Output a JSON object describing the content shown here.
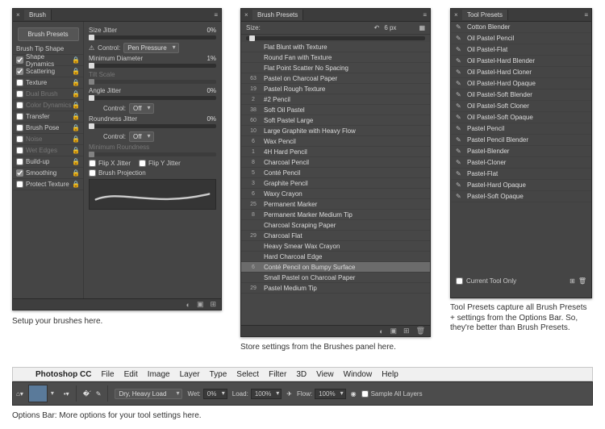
{
  "brush": {
    "title": "Brush",
    "presets_btn": "Brush Presets",
    "tip_shape": "Brush Tip Shape",
    "groups": [
      {
        "label": "Shape Dynamics",
        "checked": true,
        "enabled": true
      },
      {
        "label": "Scattering",
        "checked": true,
        "enabled": true
      },
      {
        "label": "Texture",
        "checked": false,
        "enabled": true
      },
      {
        "label": "Dual Brush",
        "checked": false,
        "enabled": false
      },
      {
        "label": "Color Dynamics",
        "checked": false,
        "enabled": false
      },
      {
        "label": "Transfer",
        "checked": false,
        "enabled": true
      },
      {
        "label": "Brush Pose",
        "checked": false,
        "enabled": true
      },
      {
        "label": "Noise",
        "checked": false,
        "enabled": false
      },
      {
        "label": "Wet Edges",
        "checked": false,
        "enabled": false
      },
      {
        "label": "Build-up",
        "checked": false,
        "enabled": true
      },
      {
        "label": "Smoothing",
        "checked": true,
        "enabled": true
      },
      {
        "label": "Protect Texture",
        "checked": false,
        "enabled": true
      }
    ],
    "size_jitter": {
      "label": "Size Jitter",
      "value": "0%"
    },
    "control1": {
      "label": "Control:",
      "value": "Pen Pressure"
    },
    "min_diameter": {
      "label": "Minimum Diameter",
      "value": "1%"
    },
    "tilt_scale": {
      "label": "Tilt Scale"
    },
    "angle_jitter": {
      "label": "Angle Jitter",
      "value": "0%"
    },
    "control2": {
      "label": "Control:",
      "value": "Off"
    },
    "roundness_jitter": {
      "label": "Roundness Jitter",
      "value": "0%"
    },
    "control3": {
      "label": "Control:",
      "value": "Off"
    },
    "min_roundness": {
      "label": "Minimum Roundness"
    },
    "flip_x": "Flip X Jitter",
    "flip_y": "Flip Y Jitter",
    "brush_projection": "Brush Projection"
  },
  "brush_caption": "Setup your brushes here.",
  "presets": {
    "title": "Brush Presets",
    "size_label": "Size:",
    "size_value": "6 px",
    "items": [
      {
        "n": "",
        "name": "Flat Blunt with Texture"
      },
      {
        "n": "",
        "name": "Round Fan with Texture"
      },
      {
        "n": "",
        "name": "Flat Point Scatter No Spacing"
      },
      {
        "n": "63",
        "name": "Pastel on Charcoal Paper"
      },
      {
        "n": "19",
        "name": "Pastel Rough Texture"
      },
      {
        "n": "2",
        "name": "#2 Pencil"
      },
      {
        "n": "38",
        "name": "Soft Oil Pastel"
      },
      {
        "n": "60",
        "name": "Soft Pastel Large"
      },
      {
        "n": "10",
        "name": "Large Graphite with Heavy Flow"
      },
      {
        "n": "6",
        "name": "Wax Pencil"
      },
      {
        "n": "1",
        "name": "4H Hard Pencil"
      },
      {
        "n": "8",
        "name": "Charcoal Pencil"
      },
      {
        "n": "5",
        "name": "Conté Pencil"
      },
      {
        "n": "3",
        "name": "Graphite Pencil"
      },
      {
        "n": "6",
        "name": "Waxy Crayon"
      },
      {
        "n": "25",
        "name": "Permanent Marker"
      },
      {
        "n": "8",
        "name": "Permanent Marker Medium Tip"
      },
      {
        "n": "",
        "name": "Charcoal Scraping Paper"
      },
      {
        "n": "29",
        "name": "Charcoal Flat"
      },
      {
        "n": "",
        "name": "Heavy Smear Wax Crayon"
      },
      {
        "n": "",
        "name": "Hard Charcoal Edge"
      },
      {
        "n": "6",
        "name": "Conté Pencil on Bumpy Surface",
        "selected": true
      },
      {
        "n": "",
        "name": "Small Pastel on Charcoal Paper"
      },
      {
        "n": "29",
        "name": "Pastel Medium Tip"
      }
    ]
  },
  "presets_caption": "Store settings from the Brushes panel here.",
  "tool": {
    "title": "Tool Presets",
    "items": [
      "Cotton Blender",
      "Oil Pastel Pencil",
      "Oil Pastel-Flat",
      "Oil Pastel-Hard Blender",
      "Oil Pastel-Hard Cloner",
      "Oil Pastel-Hard Opaque",
      "Oil Pastel-Soft Blender",
      "Oil Pastel-Soft Cloner",
      "Oil Pastel-Soft Opaque",
      "Pastel Pencil",
      "Pastel Pencil Blender",
      "Pastel-Blender",
      "Pastel-Cloner",
      "Pastel-Flat",
      "Pastel-Hard Opaque",
      "Pastel-Soft Opaque"
    ],
    "current_only": "Current Tool Only"
  },
  "tool_caption": "Tool Presets capture all Brush Presets + settings from the Options Bar. So, they're better than Brush Presets.",
  "menubar": {
    "app": "Photoshop CC",
    "items": [
      "File",
      "Edit",
      "Image",
      "Layer",
      "Type",
      "Select",
      "Filter",
      "3D",
      "View",
      "Window",
      "Help"
    ]
  },
  "options": {
    "mode": "Dry, Heavy Load",
    "wet_label": "Wet:",
    "wet": "0%",
    "load_label": "Load:",
    "load": "100%",
    "flow_label": "Flow:",
    "flow": "100%",
    "sample_all": "Sample All Layers"
  },
  "options_caption": "Options Bar: More options for your tool settings here."
}
